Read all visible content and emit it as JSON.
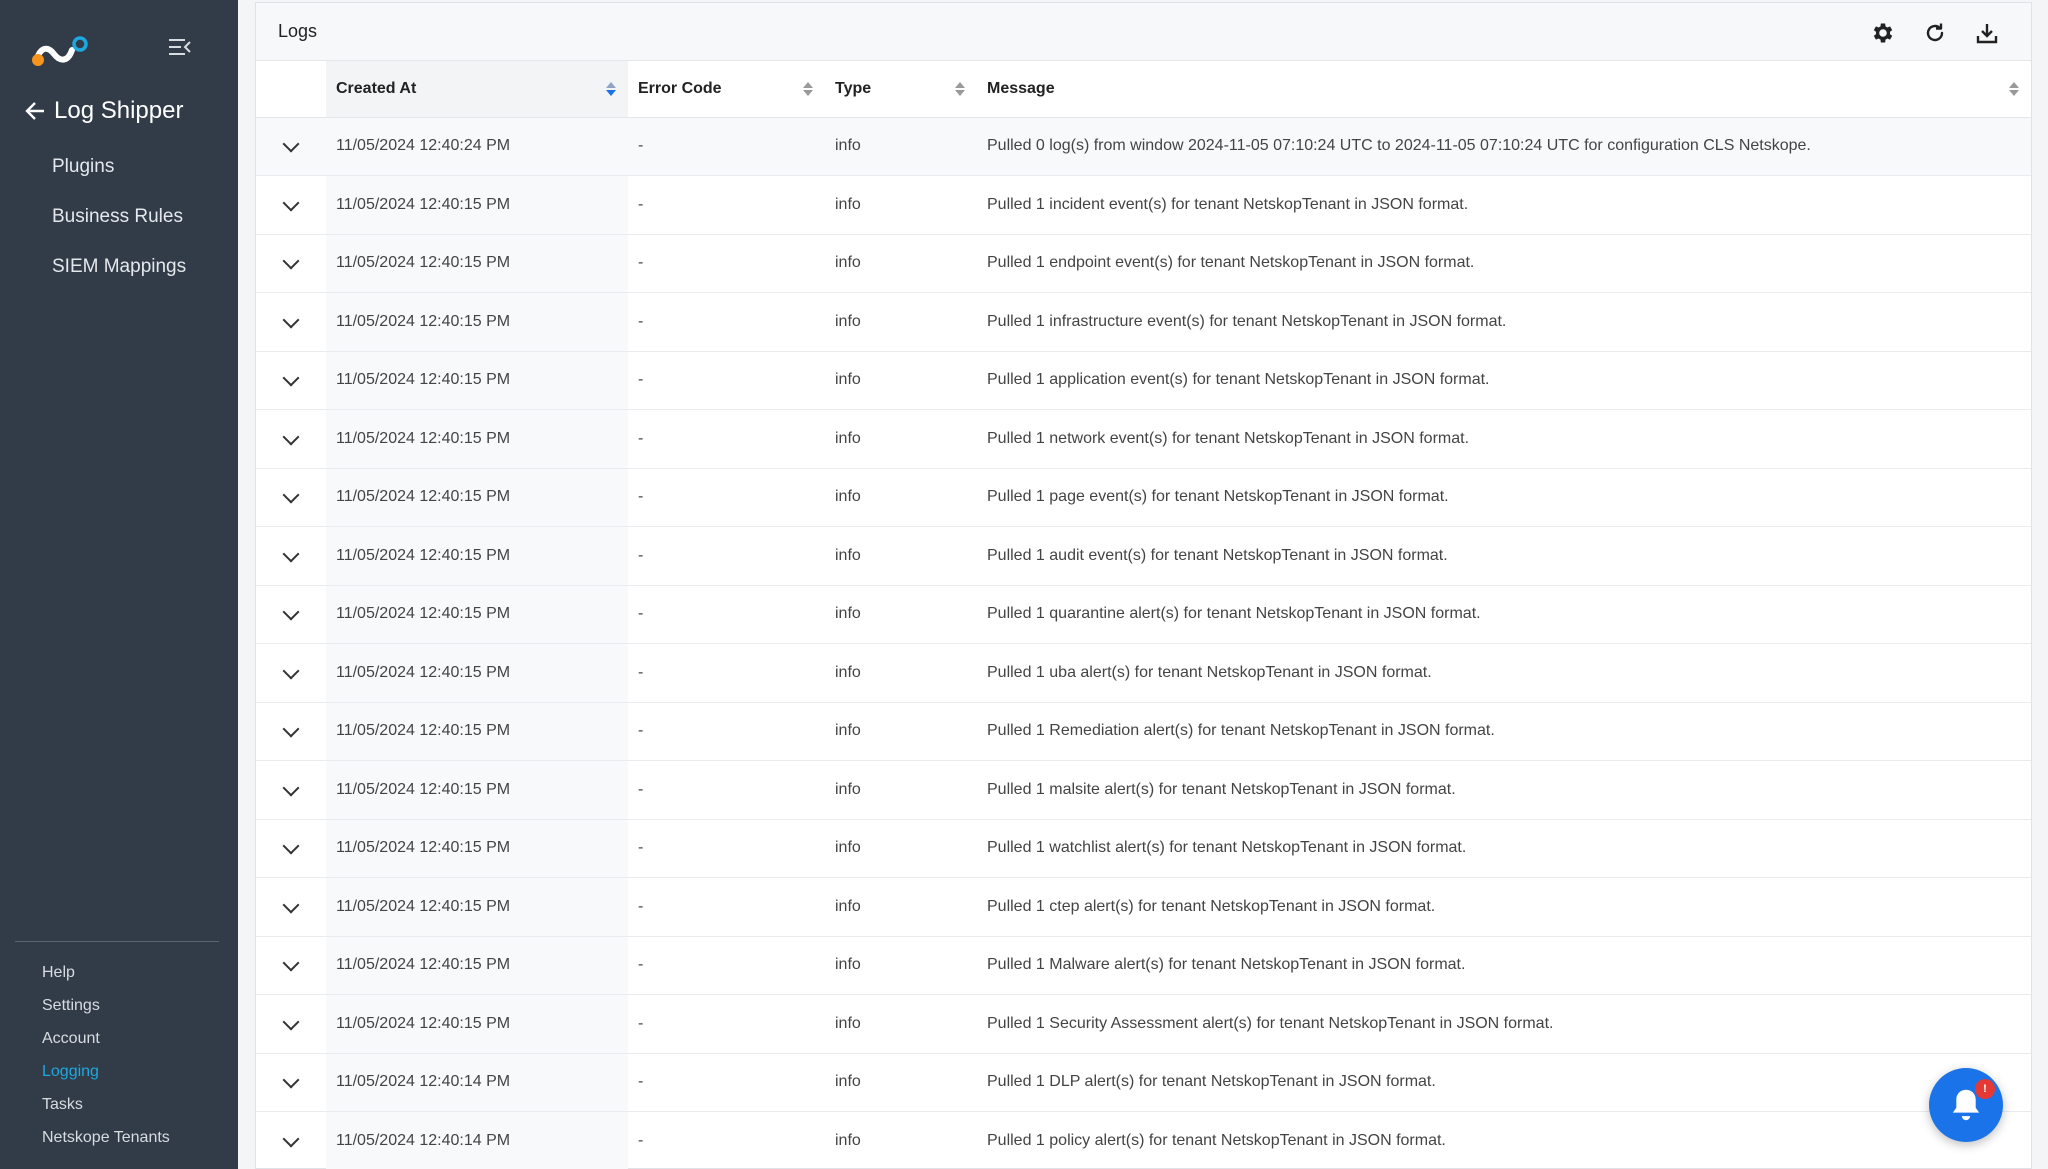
{
  "sidebar": {
    "back_label": "Log Shipper",
    "nav_items": [
      {
        "label": "Plugins"
      },
      {
        "label": "Business Rules"
      },
      {
        "label": "SIEM Mappings"
      }
    ],
    "bottom_links": [
      {
        "label": "Help",
        "active": false
      },
      {
        "label": "Settings",
        "active": false
      },
      {
        "label": "Account",
        "active": false
      },
      {
        "label": "Logging",
        "active": true
      },
      {
        "label": "Tasks",
        "active": false
      },
      {
        "label": "Netskope Tenants",
        "active": false
      }
    ]
  },
  "panel": {
    "title": "Logs",
    "actions": [
      "gear-icon",
      "refresh-icon",
      "download-icon"
    ]
  },
  "table": {
    "columns": [
      "Created At",
      "Error Code",
      "Type",
      "Message"
    ],
    "sorted_column": "Created At",
    "rows": [
      {
        "created_at": "11/05/2024 12:40:24 PM",
        "error_code": "-",
        "type": "info",
        "message": "Pulled 0 log(s) from window 2024-11-05 07:10:24 UTC to 2024-11-05 07:10:24 UTC for configuration CLS Netskope."
      },
      {
        "created_at": "11/05/2024 12:40:15 PM",
        "error_code": "-",
        "type": "info",
        "message": "Pulled 1 incident event(s) for tenant NetskopTenant in JSON format."
      },
      {
        "created_at": "11/05/2024 12:40:15 PM",
        "error_code": "-",
        "type": "info",
        "message": "Pulled 1 endpoint event(s) for tenant NetskopTenant in JSON format."
      },
      {
        "created_at": "11/05/2024 12:40:15 PM",
        "error_code": "-",
        "type": "info",
        "message": "Pulled 1 infrastructure event(s) for tenant NetskopTenant in JSON format."
      },
      {
        "created_at": "11/05/2024 12:40:15 PM",
        "error_code": "-",
        "type": "info",
        "message": "Pulled 1 application event(s) for tenant NetskopTenant in JSON format."
      },
      {
        "created_at": "11/05/2024 12:40:15 PM",
        "error_code": "-",
        "type": "info",
        "message": "Pulled 1 network event(s) for tenant NetskopTenant in JSON format."
      },
      {
        "created_at": "11/05/2024 12:40:15 PM",
        "error_code": "-",
        "type": "info",
        "message": "Pulled 1 page event(s) for tenant NetskopTenant in JSON format."
      },
      {
        "created_at": "11/05/2024 12:40:15 PM",
        "error_code": "-",
        "type": "info",
        "message": "Pulled 1 audit event(s) for tenant NetskopTenant in JSON format."
      },
      {
        "created_at": "11/05/2024 12:40:15 PM",
        "error_code": "-",
        "type": "info",
        "message": "Pulled 1 quarantine alert(s) for tenant NetskopTenant in JSON format."
      },
      {
        "created_at": "11/05/2024 12:40:15 PM",
        "error_code": "-",
        "type": "info",
        "message": "Pulled 1 uba alert(s) for tenant NetskopTenant in JSON format."
      },
      {
        "created_at": "11/05/2024 12:40:15 PM",
        "error_code": "-",
        "type": "info",
        "message": "Pulled 1 Remediation alert(s) for tenant NetskopTenant in JSON format."
      },
      {
        "created_at": "11/05/2024 12:40:15 PM",
        "error_code": "-",
        "type": "info",
        "message": "Pulled 1 malsite alert(s) for tenant NetskopTenant in JSON format."
      },
      {
        "created_at": "11/05/2024 12:40:15 PM",
        "error_code": "-",
        "type": "info",
        "message": "Pulled 1 watchlist alert(s) for tenant NetskopTenant in JSON format."
      },
      {
        "created_at": "11/05/2024 12:40:15 PM",
        "error_code": "-",
        "type": "info",
        "message": "Pulled 1 ctep alert(s) for tenant NetskopTenant in JSON format."
      },
      {
        "created_at": "11/05/2024 12:40:15 PM",
        "error_code": "-",
        "type": "info",
        "message": "Pulled 1 Malware alert(s) for tenant NetskopTenant in JSON format."
      },
      {
        "created_at": "11/05/2024 12:40:15 PM",
        "error_code": "-",
        "type": "info",
        "message": "Pulled 1 Security Assessment alert(s) for tenant NetskopTenant in JSON format."
      },
      {
        "created_at": "11/05/2024 12:40:14 PM",
        "error_code": "-",
        "type": "info",
        "message": "Pulled 1 DLP alert(s) for tenant NetskopTenant in JSON format."
      },
      {
        "created_at": "11/05/2024 12:40:14 PM",
        "error_code": "-",
        "type": "info",
        "message": "Pulled 1 policy alert(s) for tenant NetskopTenant in JSON format."
      }
    ]
  },
  "notification": {
    "badge": "!"
  },
  "colors": {
    "sidebar_bg": "#313c48",
    "accent": "#1da9e0",
    "notif_bg": "#1a73e8",
    "badge_bg": "#e53935",
    "logo_orange": "#f7941d",
    "logo_blue": "#1da9e0"
  }
}
